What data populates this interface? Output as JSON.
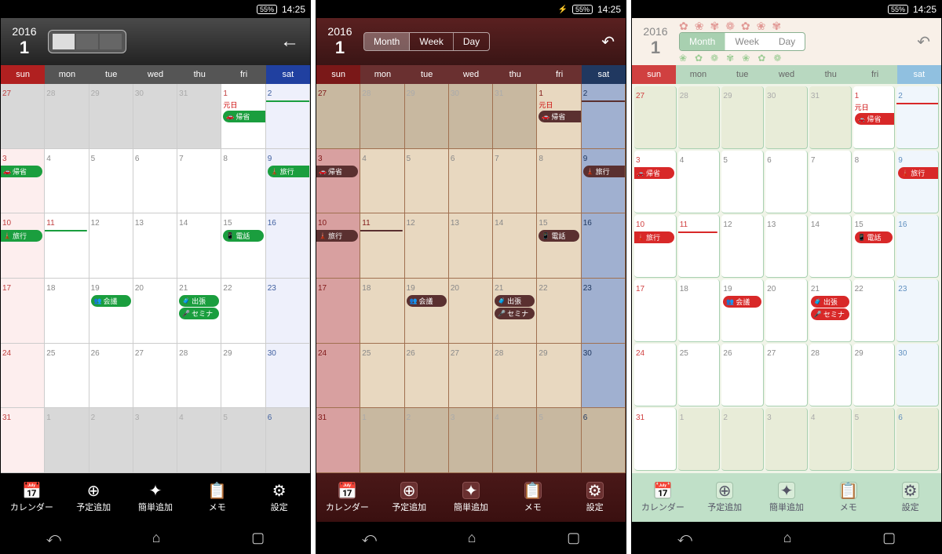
{
  "status": {
    "battery": "55%",
    "time": "14:25",
    "charging_1": false,
    "charging_2": true,
    "charging_3": false
  },
  "header": {
    "year": "2016",
    "month": "1",
    "tabs": [
      "Month",
      "Week",
      "Day"
    ],
    "selected": 0
  },
  "dow": [
    "sun",
    "mon",
    "tue",
    "wed",
    "thu",
    "fri",
    "sat"
  ],
  "toolbar": [
    {
      "label": "カレンダー",
      "icon": "calendar"
    },
    {
      "label": "予定追加",
      "icon": "plus"
    },
    {
      "label": "簡単追加",
      "icon": "star-plus"
    },
    {
      "label": "メモ",
      "icon": "note"
    },
    {
      "label": "設定",
      "icon": "gear"
    }
  ],
  "cells": [
    {
      "n": "27",
      "cls": "other sun"
    },
    {
      "n": "28",
      "cls": "other"
    },
    {
      "n": "29",
      "cls": "other"
    },
    {
      "n": "30",
      "cls": "other"
    },
    {
      "n": "31",
      "cls": "other"
    },
    {
      "n": "1",
      "cls": "hol",
      "hol": "元日",
      "ev": [
        {
          "t": "帰省",
          "span": "l",
          "ico": "🚗"
        }
      ]
    },
    {
      "n": "2",
      "cls": "sat",
      "ev": [
        {
          "t": "",
          "span": "m"
        }
      ]
    },
    {
      "n": "3",
      "cls": "sun",
      "ev": [
        {
          "t": "帰省",
          "span": "r",
          "ico": "🚗"
        },
        {
          "t": "",
          "blank": true
        }
      ]
    },
    {
      "n": "4",
      "cls": "",
      "ev": [
        {
          "t": "",
          "span": "r",
          "blank2": true
        }
      ]
    },
    {
      "n": "5"
    },
    {
      "n": "6"
    },
    {
      "n": "7"
    },
    {
      "n": "8"
    },
    {
      "n": "9",
      "cls": "sat",
      "ev": [
        {
          "t": "旅行",
          "span": "l",
          "ico": "🗼"
        }
      ]
    },
    {
      "n": "10",
      "cls": "sun",
      "ev": [
        {
          "t": "旅行",
          "span": "r",
          "ico": "🗼"
        }
      ]
    },
    {
      "n": "11",
      "cls": "hol",
      "ev": [
        {
          "t": "",
          "span": "r"
        }
      ]
    },
    {
      "n": "12"
    },
    {
      "n": "13"
    },
    {
      "n": "14"
    },
    {
      "n": "15",
      "ev": [
        {
          "t": "電話",
          "ico": "📱"
        }
      ]
    },
    {
      "n": "16",
      "cls": "sat"
    },
    {
      "n": "17",
      "cls": "sun"
    },
    {
      "n": "18"
    },
    {
      "n": "19",
      "ev": [
        {
          "t": "会議",
          "ico": "👥"
        }
      ]
    },
    {
      "n": "20"
    },
    {
      "n": "21",
      "ev": [
        {
          "t": "出張",
          "ico": "🧳"
        },
        {
          "t": "セミナ",
          "ico": "🎤"
        }
      ]
    },
    {
      "n": "22"
    },
    {
      "n": "23",
      "cls": "sat"
    },
    {
      "n": "24",
      "cls": "sun"
    },
    {
      "n": "25"
    },
    {
      "n": "26"
    },
    {
      "n": "27"
    },
    {
      "n": "28"
    },
    {
      "n": "29"
    },
    {
      "n": "30",
      "cls": "sat"
    },
    {
      "n": "31",
      "cls": "sun"
    },
    {
      "n": "1",
      "cls": "other"
    },
    {
      "n": "2",
      "cls": "other"
    },
    {
      "n": "3",
      "cls": "other"
    },
    {
      "n": "4",
      "cls": "other"
    },
    {
      "n": "5",
      "cls": "other"
    },
    {
      "n": "6",
      "cls": "other sat"
    }
  ]
}
